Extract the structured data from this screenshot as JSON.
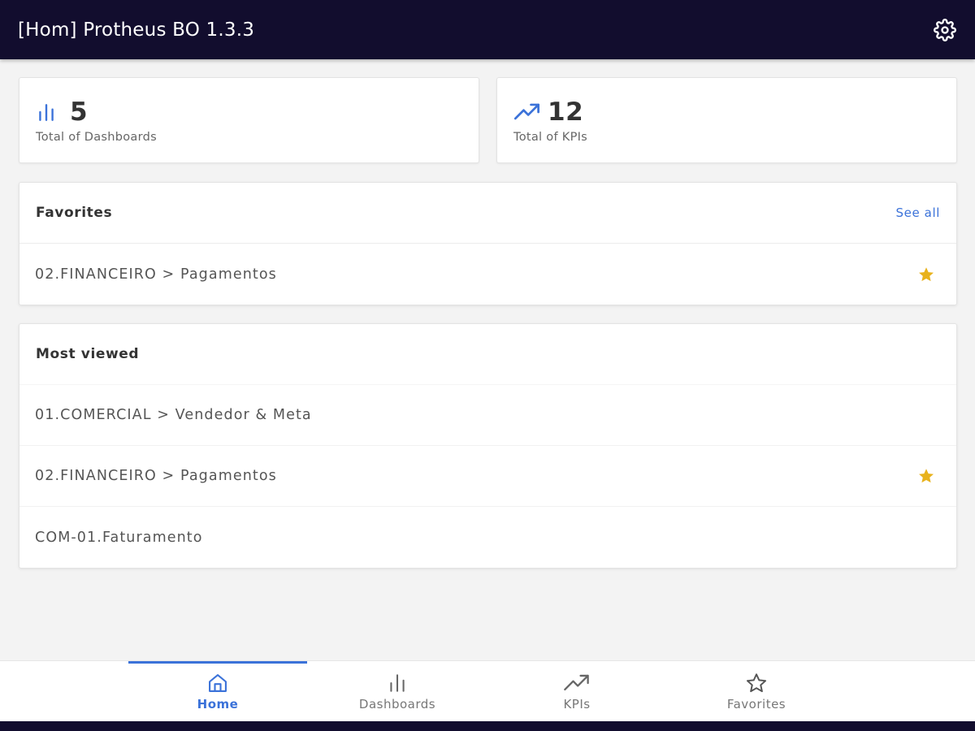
{
  "app_bar": {
    "title": "[Hom] Protheus BO 1.3.3",
    "settings_icon": "gear-icon"
  },
  "stats": [
    {
      "icon": "bar-chart-icon",
      "value": "5",
      "label": "Total of Dashboards"
    },
    {
      "icon": "trending-up-icon",
      "value": "12",
      "label": "Total of KPIs"
    }
  ],
  "favorites": {
    "title": "Favorites",
    "see_all_label": "See all",
    "items": [
      {
        "label": "02.FINANCEIRO > Pagamentos",
        "favorite": true
      }
    ]
  },
  "most_viewed": {
    "title": "Most viewed",
    "items": [
      {
        "label": "01.COMERCIAL > Vendedor & Meta",
        "favorite": false
      },
      {
        "label": "02.FINANCEIRO > Pagamentos",
        "favorite": true
      },
      {
        "label": "COM-01.Faturamento",
        "favorite": false
      }
    ]
  },
  "bottom_nav": {
    "items": [
      {
        "label": "Home",
        "icon": "home-icon",
        "active": true
      },
      {
        "label": "Dashboards",
        "icon": "bar-chart-icon",
        "active": false
      },
      {
        "label": "KPIs",
        "icon": "trending-up-icon",
        "active": false
      },
      {
        "label": "Favorites",
        "icon": "star-outline-icon",
        "active": false
      }
    ]
  },
  "colors": {
    "app_bar": "#120d2e",
    "accent": "#3b72d9",
    "star": "#e8b21c",
    "background": "#f3f3f3"
  }
}
